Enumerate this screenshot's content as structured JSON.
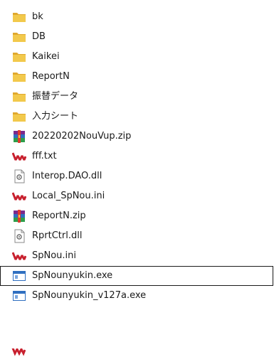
{
  "files": [
    {
      "name": "bk",
      "icon": "folder-icon"
    },
    {
      "name": "DB",
      "icon": "folder-icon"
    },
    {
      "name": "Kaikei",
      "icon": "folder-icon"
    },
    {
      "name": "ReportN",
      "icon": "folder-icon"
    },
    {
      "name": "振替データ",
      "icon": "folder-icon"
    },
    {
      "name": "入力シート",
      "icon": "folder-icon"
    },
    {
      "name": "20220202NouVup.zip",
      "icon": "winrar-archive-icon"
    },
    {
      "name": "fff.txt",
      "icon": "editor-file-icon"
    },
    {
      "name": "Interop.DAO.dll",
      "icon": "dll-file-icon"
    },
    {
      "name": "Local_SpNou.ini",
      "icon": "editor-file-icon"
    },
    {
      "name": "ReportN.zip",
      "icon": "winrar-archive-icon"
    },
    {
      "name": "RprtCtrl.dll",
      "icon": "dll-file-icon"
    },
    {
      "name": "SpNou.ini",
      "icon": "editor-file-icon"
    },
    {
      "name": "SpNounyukin.exe",
      "icon": "exe-window-icon"
    },
    {
      "name": "SpNounyukin_v127a.exe",
      "icon": "exe-window-icon"
    }
  ],
  "selected_index": 13,
  "colors": {
    "folder": "#f2c94c",
    "folder_shade": "#e0a82e",
    "editor_red": "#c8202e",
    "archive_purple": "#7b2a8c",
    "exe_blue": "#2f6fc0",
    "selection_border": "#1a1a1a"
  }
}
